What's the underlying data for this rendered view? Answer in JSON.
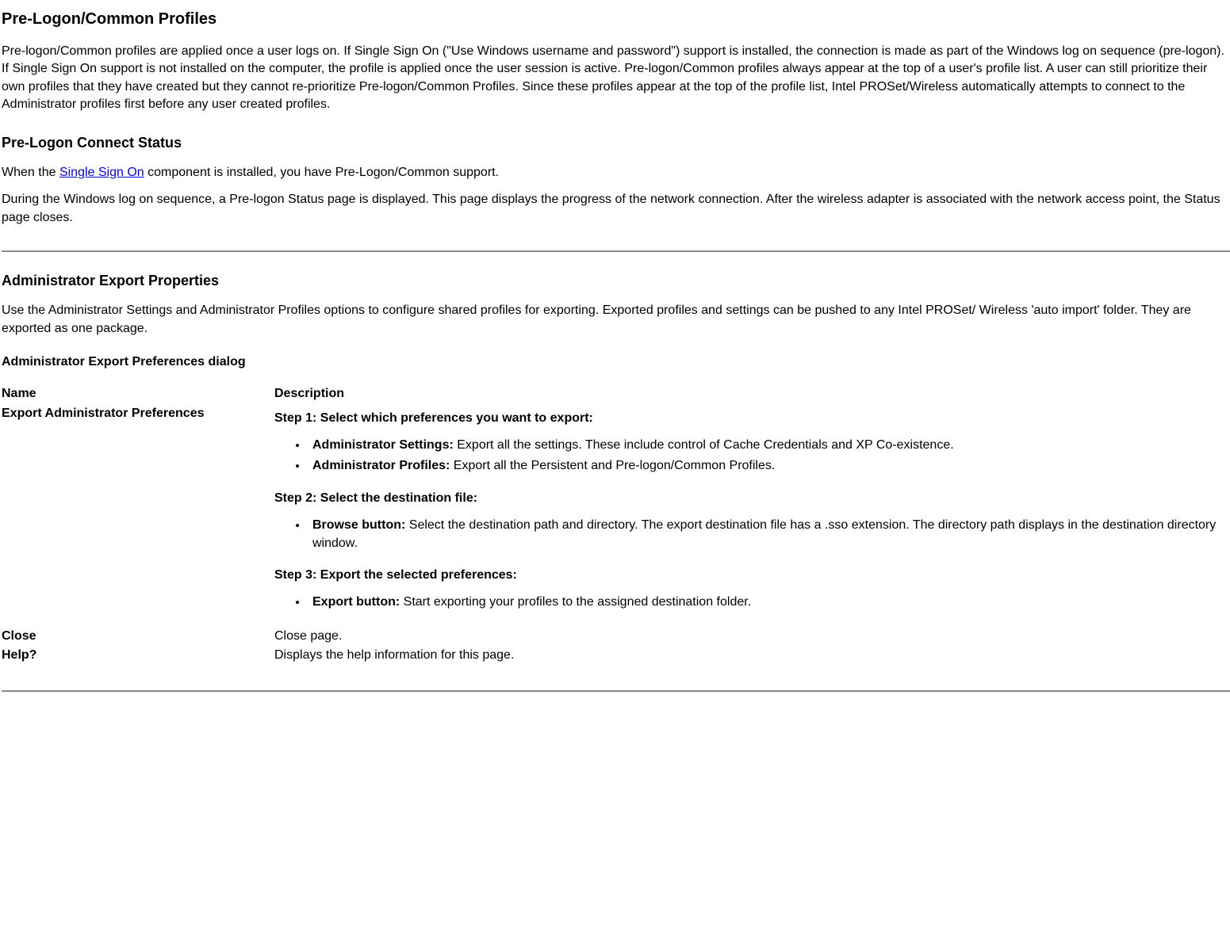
{
  "section1": {
    "heading": "Pre-Logon/Common Profiles",
    "paragraph": "Pre-logon/Common profiles are applied once a user logs on. If Single Sign On (\"Use Windows username and password\") support is installed, the connection is made as part of the Windows log on sequence (pre-logon). If Single Sign On support is not installed on the computer, the profile is applied once the user session is active. Pre-logon/Common profiles always appear at the top of a user's profile list. A user can still prioritize their own profiles that they have created but they cannot re-prioritize Pre-logon/Common Profiles. Since these profiles appear at the top of the profile list, Intel PROSet/Wireless  automatically attempts to connect to the Administrator profiles first before any user created profiles."
  },
  "section2": {
    "heading": "Pre-Logon Connect Status",
    "p1_pre": "When the ",
    "p1_link": "Single Sign On",
    "p1_post": " component is installed, you have Pre-Logon/Common support.",
    "p2": "During the Windows log on sequence, a Pre-logon Status page is displayed. This page displays the progress of the network connection. After the wireless adapter is associated with the network access point, the Status page closes."
  },
  "section3": {
    "heading": "Administrator Export Properties",
    "paragraph": "Use the Administrator Settings and Administrator Profiles options to configure shared profiles for exporting. Exported profiles and settings can be pushed to any Intel PROSet/ Wireless  'auto import' folder. They are exported as one package.",
    "dialog_title": "Administrator Export Preferences dialog",
    "table": {
      "header_name": "Name",
      "header_desc": "Description",
      "row1_name": "Export Administrator Preferences",
      "step1": "Step 1: Select which preferences you want to export:",
      "s1_b1_label": "Administrator Settings:",
      "s1_b1_text": " Export all the settings. These include control of Cache Credentials and XP Co-existence.",
      "s1_b2_label": "Administrator Profiles:",
      "s1_b2_text": " Export all the Persistent and Pre-logon/Common Profiles.",
      "step2": "Step 2: Select the destination file:",
      "s2_b1_label": "Browse button:",
      "s2_b1_text": " Select the destination path and directory. The export destination file has a .sso extension. The directory path displays in the destination directory window.",
      "step3": "Step 3: Export the selected preferences:",
      "s3_b1_label": "Export button:",
      "s3_b1_text": " Start exporting your profiles to the assigned destination folder.",
      "row2_name": "Close",
      "row2_desc": "Close page.",
      "row3_name": "Help?",
      "row3_desc": "Displays the help information for this page."
    }
  }
}
